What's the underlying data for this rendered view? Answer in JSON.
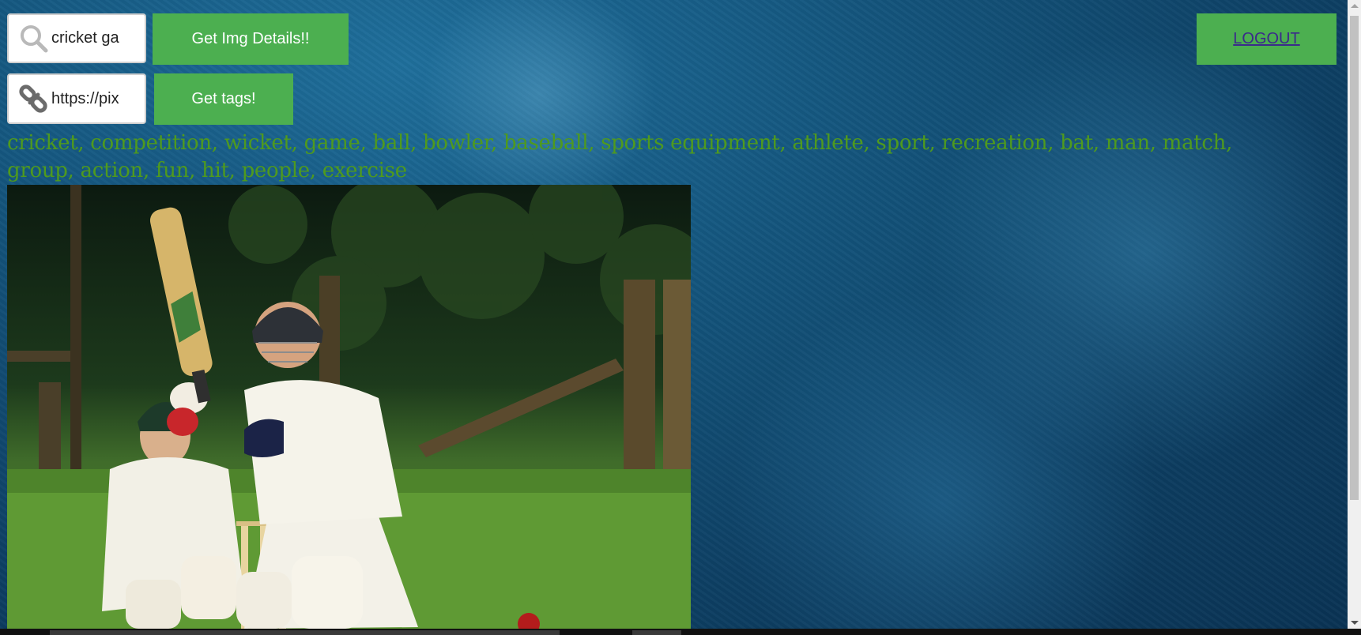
{
  "search": {
    "icon": "search-icon",
    "value": "cricket ga",
    "button_label": "Get Img Details!!"
  },
  "url": {
    "icon": "link-icon",
    "value": "https://pix",
    "button_label": "Get tags!"
  },
  "header": {
    "logout_label": "LOGOUT"
  },
  "tags_text": "cricket, competition, wicket, game, ball, bowler, baseball, sports equipment, athlete, sport, recreation, bat, man, match, group, action, fun, hit, people, exercise",
  "colors": {
    "button_green": "#4caf50",
    "tags_green": "#4f9a1e",
    "background_blue": "#14557d"
  }
}
